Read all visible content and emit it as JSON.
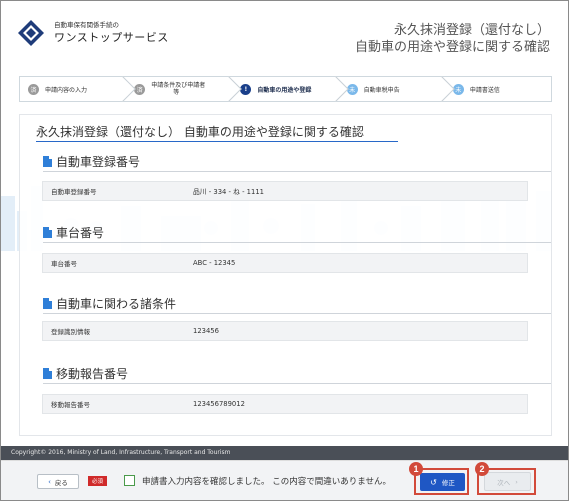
{
  "header": {
    "org_small": "自動車保有関係手続の",
    "org_big": "ワンストップサービス",
    "title_line1": "永久抹消登録（還付なし）",
    "title_line2": "自動車の用途や登録に関する確認"
  },
  "stepper": [
    {
      "badge": "済",
      "label": "申請内容の入力",
      "state": "done"
    },
    {
      "badge": "済",
      "label_line1": "申請条件及び申請者",
      "label_line2": "等",
      "state": "done"
    },
    {
      "badge": "!",
      "label": "自動車の用途や登録",
      "state": "current"
    },
    {
      "badge": "未",
      "label": "自動車税申告",
      "state": "todo"
    },
    {
      "badge": "未",
      "label": "申請書送信",
      "state": "todo"
    }
  ],
  "card": {
    "title": "永久抹消登録（還付なし） 自動車の用途や登録に関する確認"
  },
  "sections": [
    {
      "heading": "自動車登録番号",
      "label": "自動車登録番号",
      "value": "品川 - 334 - ね - 1111"
    },
    {
      "heading": "車台番号",
      "label": "車台番号",
      "value": "ABC - 12345"
    },
    {
      "heading": "自動車に関わる諸条件",
      "label": "登録識別情報",
      "value": "123456"
    },
    {
      "heading": "移動報告番号",
      "label": "移動報告番号",
      "value": "123456789012"
    }
  ],
  "footer": {
    "copyright": "Copyright© 2016, Ministry of Land, Infrastructure, Transport and Tourism",
    "back_label": "戻る",
    "required_badge": "必須",
    "confirm_text": "申請書入力内容を確認しました。 この内容で間違いありません。",
    "fix_label": "修正",
    "next_label": "次へ",
    "callout_1": "1",
    "callout_2": "2"
  },
  "colors": {
    "accent": "#1f57c4",
    "current_step": "#1a3f8a",
    "done_step": "#9a9a9a",
    "todo_step": "#7ab8ea",
    "highlight": "#d24a3a",
    "required": "#d02a2a"
  }
}
